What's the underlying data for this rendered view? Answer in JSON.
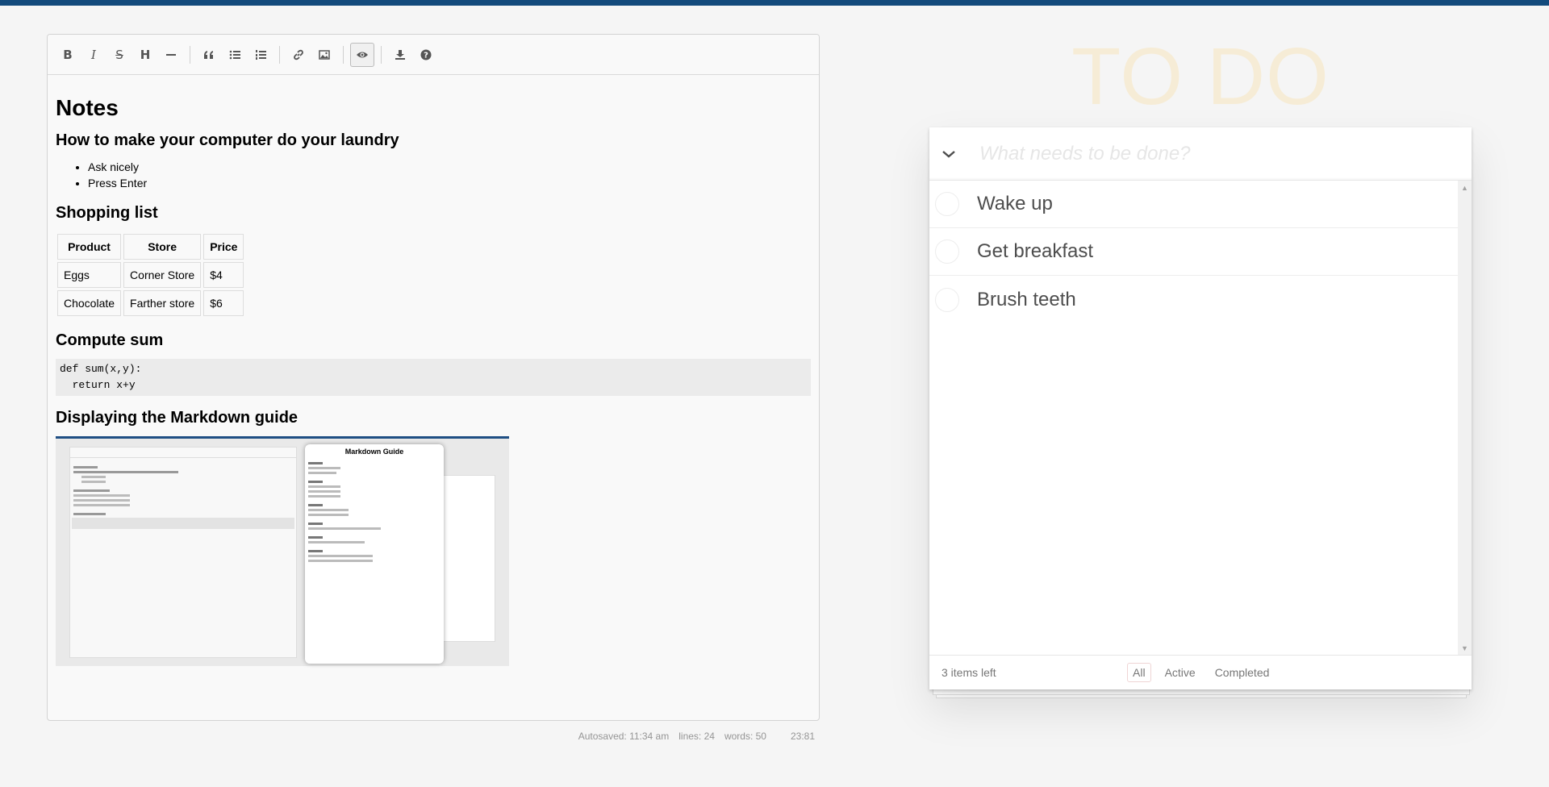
{
  "editor": {
    "toolbar": {
      "icons": [
        "bold-icon",
        "italic-icon",
        "strikethrough-icon",
        "heading-icon",
        "horizontal-rule-icon",
        "quote-icon",
        "unordered-list-icon",
        "ordered-list-icon",
        "link-icon",
        "image-icon",
        "preview-eye-icon",
        "download-icon",
        "help-icon"
      ],
      "glyphs": {
        "bold": "B",
        "italic": "I",
        "strike": "S",
        "heading": "H"
      }
    },
    "content": {
      "h1": "Notes",
      "h2_laundry": "How to make your computer do your laundry",
      "list": [
        "Ask nicely",
        "Press Enter"
      ],
      "h2_shopping": "Shopping list",
      "table": {
        "headers": [
          "Product",
          "Store",
          "Price"
        ],
        "rows": [
          [
            "Eggs",
            "Corner Store",
            "$4"
          ],
          [
            "Chocolate",
            "Farther store",
            "$6"
          ]
        ]
      },
      "h2_sum": "Compute sum",
      "code_lines": [
        "def sum(x,y):",
        "  return x+y"
      ],
      "h2_guide": "Displaying the Markdown guide",
      "guide_image_title": "Markdown Guide"
    },
    "status": {
      "autosaved": "Autosaved: 11:34 am",
      "lines": "lines: 24",
      "words": "words: 50",
      "cursor": "23:81"
    }
  },
  "todo": {
    "title": "TO DO",
    "placeholder": "What needs to be done?",
    "items": [
      "Wake up",
      "Get breakfast",
      "Brush teeth"
    ],
    "count": "3 items left",
    "filters": {
      "all": "All",
      "active": "Active",
      "completed": "Completed"
    },
    "selected_filter": "All"
  }
}
